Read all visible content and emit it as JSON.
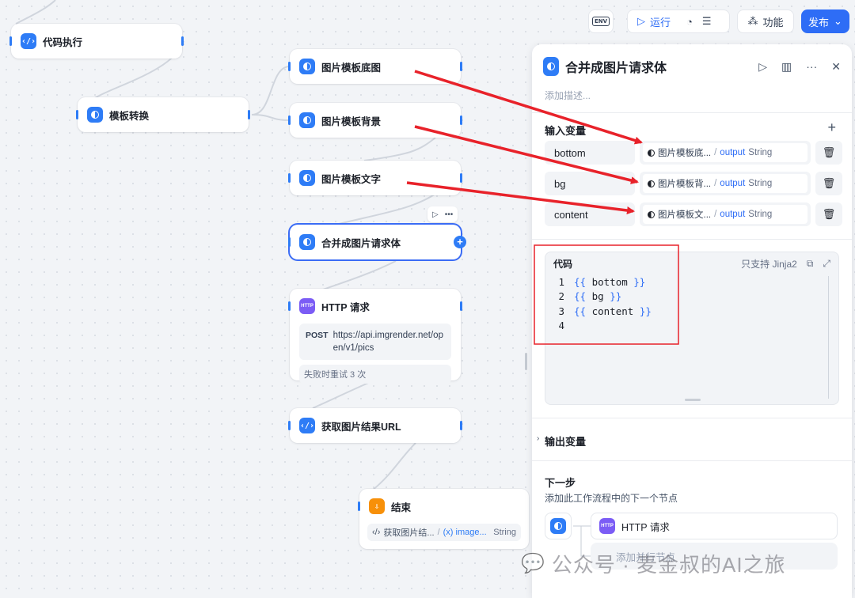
{
  "toolbar": {
    "env": "ENV",
    "run": "运行",
    "features": "功能",
    "publish": "发布"
  },
  "canvas": {
    "nodes": {
      "code_exec": "代码执行",
      "template_convert": "模板转换",
      "img_tpl_base": "图片模板底图",
      "img_tpl_bg": "图片模板背景",
      "img_tpl_text": "图片模板文字",
      "merge_body": "合并成图片请求体",
      "http": {
        "title": "HTTP 请求",
        "method": "POST",
        "url": "https://api.imgrender.net/open/v1/pics",
        "retry": "失败时重试 3 次"
      },
      "get_url": "获取图片结果URL",
      "end": {
        "title": "结束",
        "src": "获取图片结...",
        "var": "(x) image...",
        "type": "String"
      }
    },
    "colors": {
      "arrow": "#e8222a",
      "highlight_box": "#e8222a",
      "accent": "#2e6df6"
    }
  },
  "panel": {
    "title": "合并成图片请求体",
    "description_placeholder": "添加描述...",
    "input_title": "输入变量",
    "variables": [
      {
        "name": "bottom",
        "source": "图片模板底...",
        "output": "output",
        "type": "String"
      },
      {
        "name": "bg",
        "source": "图片模板背...",
        "output": "output",
        "type": "String"
      },
      {
        "name": "content",
        "source": "图片模板文...",
        "output": "output",
        "type": "String"
      }
    ],
    "code": {
      "label": "代码",
      "support": "只支持 Jinja2",
      "lines": [
        {
          "num": "1",
          "open": "{{",
          "var": "bottom",
          "close": "}}"
        },
        {
          "num": "2",
          "open": "{{",
          "var": "bg",
          "close": "}}"
        },
        {
          "num": "3",
          "open": "{{",
          "var": "content",
          "close": "}}"
        },
        {
          "num": "4",
          "open": "",
          "var": "",
          "close": ""
        }
      ]
    },
    "output_title": "输出变量",
    "next": {
      "title": "下一步",
      "subtitle": "添加此工作流程中的下一个节点",
      "node": "HTTP 请求",
      "add_parallel": "添加并行节点"
    }
  },
  "watermark": "公众号 · 麦金叔的AI之旅"
}
